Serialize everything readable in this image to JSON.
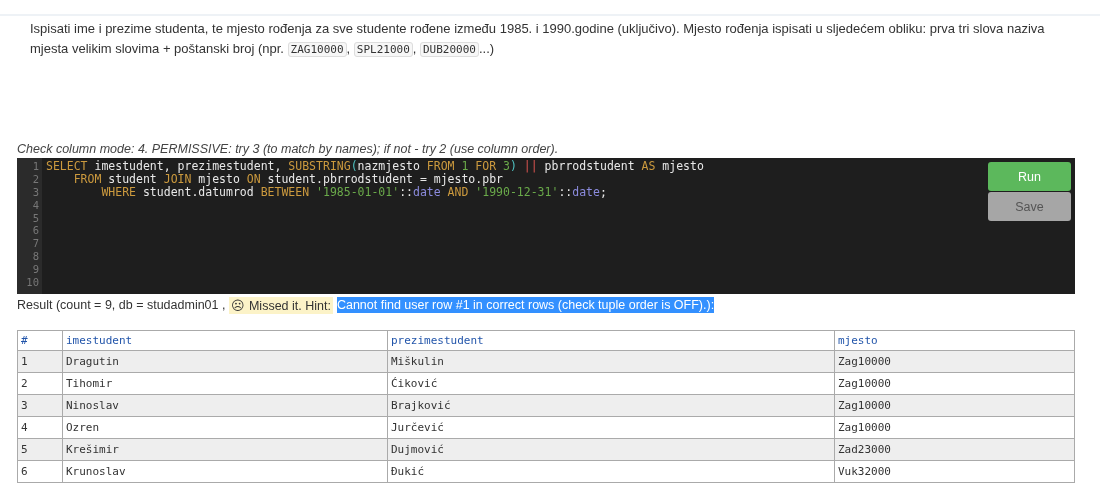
{
  "task": {
    "text": "Ispisati ime i prezime studenta, te mjesto rođenja za sve studente rođene između 1985. i 1990.godine (uključivo). Mjesto rođenja ispisati u sljedećem obliku: prva tri slova naziva mjesta velikim slovima + poštanski broj (npr. ",
    "examples": [
      "ZAG10000",
      "SPL21000",
      "DUB20000"
    ],
    "separator": ", ",
    "tail": "...)"
  },
  "check_mode": "Check column mode: 4. PERMISSIVE: try 3 (to match by names); if not - try 2 (use column order).",
  "editor": {
    "line_numbers": [
      "1",
      "2",
      "3",
      "4",
      "5",
      "6",
      "7",
      "8",
      "9",
      "10"
    ],
    "lines": [
      [
        {
          "kind": "kw",
          "text": "SELECT"
        },
        {
          "kind": "id",
          "text": " imestudent, prezimestudent, "
        },
        {
          "kind": "kw",
          "text": "SUBSTRING"
        },
        {
          "kind": "paren",
          "text": "("
        },
        {
          "kind": "id",
          "text": "nazmjesto "
        },
        {
          "kind": "kw",
          "text": "FROM "
        },
        {
          "kind": "num",
          "text": "1 "
        },
        {
          "kind": "kw",
          "text": "FOR "
        },
        {
          "kind": "num",
          "text": "3"
        },
        {
          "kind": "paren",
          "text": ") "
        },
        {
          "kind": "op",
          "text": "||"
        },
        {
          "kind": "id",
          "text": " pbrrodstudent "
        },
        {
          "kind": "kw",
          "text": "AS"
        },
        {
          "kind": "id",
          "text": " mjesto"
        }
      ],
      [
        {
          "kind": "kw",
          "text": "    FROM"
        },
        {
          "kind": "id",
          "text": " student "
        },
        {
          "kind": "kw",
          "text": "JOIN"
        },
        {
          "kind": "id",
          "text": " mjesto "
        },
        {
          "kind": "kw",
          "text": "ON"
        },
        {
          "kind": "id",
          "text": " student.pbrrodstudent = mjesto.pbr"
        }
      ],
      [
        {
          "kind": "kw",
          "text": "        WHERE"
        },
        {
          "kind": "id",
          "text": " student.datumrod "
        },
        {
          "kind": "kw",
          "text": "BETWEEN "
        },
        {
          "kind": "str",
          "text": "'1985-01-01'"
        },
        {
          "kind": "id",
          "text": "::"
        },
        {
          "kind": "type",
          "text": "date"
        },
        {
          "kind": "kw",
          "text": " AND "
        },
        {
          "kind": "str",
          "text": "'1990-12-31'"
        },
        {
          "kind": "id",
          "text": "::"
        },
        {
          "kind": "type",
          "text": "date"
        },
        {
          "kind": "id",
          "text": ";"
        }
      ]
    ]
  },
  "buttons": [
    {
      "label": "Run",
      "kind": "primary"
    },
    {
      "label": "Save",
      "kind": "secondary"
    }
  ],
  "result": {
    "summary": "Result (count = 9, db = studadmin01 ,",
    "missed": "☹ Missed it. Hint:",
    "hint": "Cannot find user row #1 in correct rows (check tuple order is OFF).):",
    "hint_selected": true
  },
  "table": {
    "columns": [
      "#",
      "imestudent",
      "prezimestudent",
      "mjesto"
    ],
    "rows": [
      [
        "1",
        "Dragutin",
        "Miškulin",
        "Zag10000"
      ],
      [
        "2",
        "Tihomir",
        "Ćiković",
        "Zag10000"
      ],
      [
        "3",
        "Ninoslav",
        "Brajković",
        "Zag10000"
      ],
      [
        "4",
        "Ozren",
        "Jurčević",
        "Zag10000"
      ],
      [
        "5",
        "Krešimir",
        "Dujmović",
        "Zad23000"
      ],
      [
        "6",
        "Krunoslav",
        "Đukić",
        "Vuk32000"
      ]
    ]
  }
}
